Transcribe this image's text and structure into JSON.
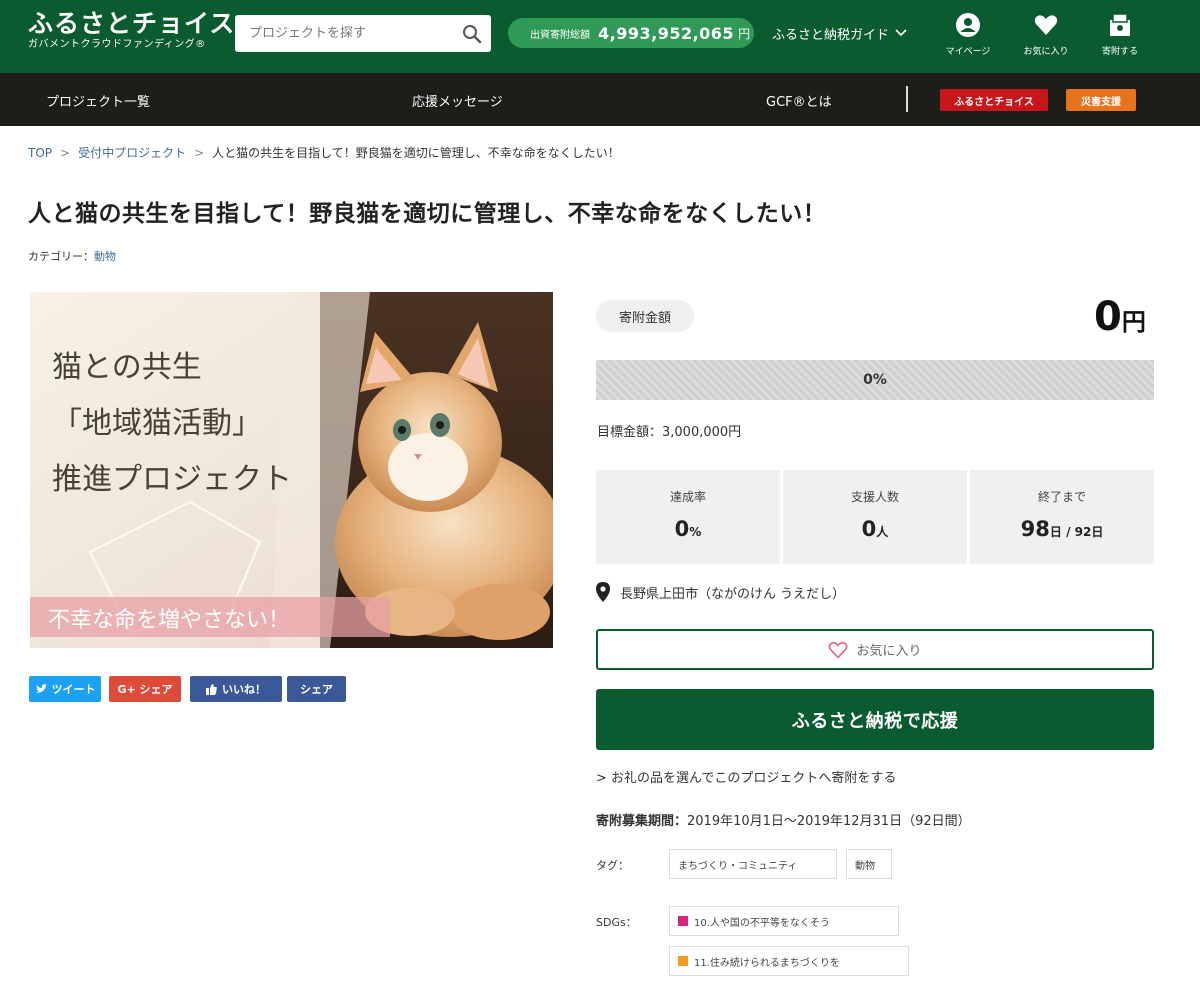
{
  "header": {
    "logo_main": "ふるさとチョイス",
    "logo_sub": "ガバメントクラウドファンディング®",
    "search_placeholder": "プロジェクトを探す",
    "counter_label": "出資寄附総額",
    "counter_value": "4,993,952,065",
    "counter_unit": "円",
    "guide_label": "ふるさと納税ガイド",
    "icons": [
      {
        "label": "マイページ",
        "icon": "user-icon"
      },
      {
        "label": "お気に入り",
        "icon": "heart-icon"
      },
      {
        "label": "寄附する",
        "icon": "donate-icon"
      }
    ]
  },
  "subnav": {
    "items": [
      "プロジェクト一覧",
      "応援メッセージ",
      "GCF®とは"
    ],
    "btn_choice": "ふるさとチョイス",
    "btn_disaster": "災害支援"
  },
  "breadcrumb": {
    "top": "TOP",
    "sep": ">",
    "accepting": "受付中プロジェクト",
    "current": "人と猫の共生を目指して！野良猫を適切に管理し、不幸な命をなくしたい！"
  },
  "page_title": "人と猫の共生を目指して！野良猫を適切に管理し、不幸な命をなくしたい！",
  "category": {
    "label": "カテゴリー：",
    "value": "動物"
  },
  "hero": {
    "line1": "猫との共生",
    "line2": "「地域猫活動」",
    "line3": "推進プロジェクト",
    "banner": "不幸な命を増やさない！"
  },
  "share": {
    "tweet": "ツイート",
    "gplus": "G+ シェア",
    "like": "いいね！",
    "fb_share": "シェア"
  },
  "funding": {
    "badge": "寄附金額",
    "amount": "0",
    "amount_unit": "円",
    "progress_label": "0%",
    "progress_fraction": 0,
    "target": "目標金額：3,000,000円",
    "stats": [
      {
        "label": "達成率",
        "value": "0",
        "unit": "%"
      },
      {
        "label": "支援人数",
        "value": "0",
        "unit": "人"
      },
      {
        "label": "終了まで",
        "value": "98",
        "unit": "日 / 92日"
      }
    ],
    "location": "長野県上田市（ながのけん うえだし）",
    "fav_label": "お気に入り",
    "support_label": "ふるさと納税で応援",
    "gift_link": "> お礼の品を選んでこのプロジェクトへ寄附をする",
    "period_label": "寄附募集期間：",
    "period_value": "2019年10月1日～2019年12月31日（92日間）",
    "tags_label": "タグ：",
    "tags": [
      "まちづくり・コミュニティ",
      "動物"
    ],
    "sdgs_label": "SDGs：",
    "sdgs": [
      {
        "label": "10.人や国の不平等をなくそう",
        "color": "#d8267e"
      },
      {
        "label": "11.住み続けられるまちづくりを",
        "color": "#f29c1f"
      }
    ]
  },
  "colors": {
    "brand_green": "#0b5b30",
    "counter_green": "#2f9a55",
    "nav_dark": "#1f1d1a",
    "choice_red": "#c8161d",
    "disaster_orange": "#e8731f",
    "twitter": "#1da1f2",
    "gplus": "#dd4b39",
    "facebook": "#3b5998"
  }
}
